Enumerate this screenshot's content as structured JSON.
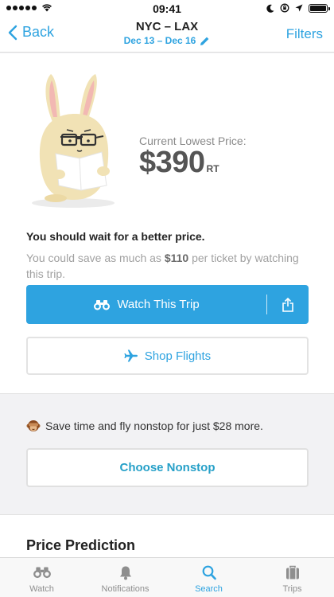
{
  "status_bar": {
    "time": "09:41"
  },
  "nav": {
    "back_label": "Back",
    "title": "NYC – LAX",
    "dates": "Dec 13 – Dec 16",
    "filters_label": "Filters"
  },
  "price": {
    "label": "Current Lowest Price:",
    "value": "$390",
    "suffix": "RT"
  },
  "advice": {
    "headline": "You should wait for a better price.",
    "save_prefix": "You could save as much as ",
    "save_amount": "$110",
    "save_suffix": " per ticket by watching this trip."
  },
  "actions": {
    "watch_label": "Watch This Trip",
    "shop_label": "Shop Flights"
  },
  "nonstop": {
    "text": "Save time and fly nonstop for just $28 more.",
    "button_label": "Choose Nonstop"
  },
  "prediction": {
    "title": "Price Prediction"
  },
  "tabs": [
    {
      "label": "Watch",
      "icon": "binoculars-icon",
      "active": false
    },
    {
      "label": "Notifications",
      "icon": "bell-icon",
      "active": false
    },
    {
      "label": "Search",
      "icon": "search-icon",
      "active": true
    },
    {
      "label": "Trips",
      "icon": "suitcase-icon",
      "active": false
    }
  ],
  "colors": {
    "accent": "#2ea3e0",
    "background": "#f2f2f4",
    "card": "#ffffff"
  }
}
